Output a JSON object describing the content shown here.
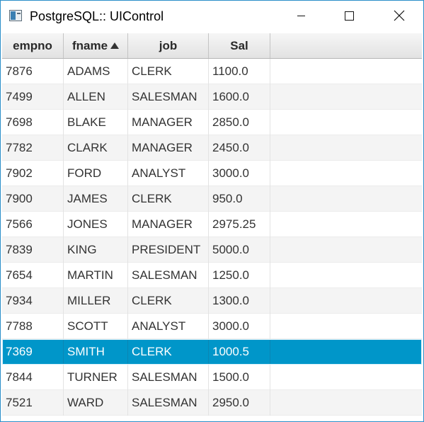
{
  "window": {
    "title": "PostgreSQL:: UIControl",
    "icon": "app-window-icon",
    "controls": [
      "minimize-icon",
      "maximize-icon",
      "close-icon"
    ]
  },
  "table": {
    "columns": [
      {
        "label": "empno",
        "sorted": false
      },
      {
        "label": "fname",
        "sorted": "ascending"
      },
      {
        "label": "job",
        "sorted": false
      },
      {
        "label": "Sal",
        "sorted": false
      }
    ],
    "rows": [
      [
        "7876",
        "ADAMS",
        "CLERK",
        "1100.0"
      ],
      [
        "7499",
        "ALLEN",
        "SALESMAN",
        "1600.0"
      ],
      [
        "7698",
        "BLAKE",
        "MANAGER",
        "2850.0"
      ],
      [
        "7782",
        "CLARK",
        "MANAGER",
        "2450.0"
      ],
      [
        "7902",
        "FORD",
        "ANALYST",
        "3000.0"
      ],
      [
        "7900",
        "JAMES",
        "CLERK",
        "950.0"
      ],
      [
        "7566",
        "JONES",
        "MANAGER",
        "2975.25"
      ],
      [
        "7839",
        "KING",
        "PRESIDENT",
        "5000.0"
      ],
      [
        "7654",
        "MARTIN",
        "SALESMAN",
        "1250.0"
      ],
      [
        "7934",
        "MILLER",
        "CLERK",
        "1300.0"
      ],
      [
        "7788",
        "SCOTT",
        "ANALYST",
        "3000.0"
      ],
      [
        "7369",
        "SMITH",
        "CLERK",
        "1000.5"
      ],
      [
        "7844",
        "TURNER",
        "SALESMAN",
        "1500.0"
      ],
      [
        "7521",
        "WARD",
        "SALESMAN",
        "2950.0"
      ]
    ],
    "selected_row": 11
  },
  "colors": {
    "selection": "#0096c9",
    "window_border": "#2b8fc9"
  }
}
